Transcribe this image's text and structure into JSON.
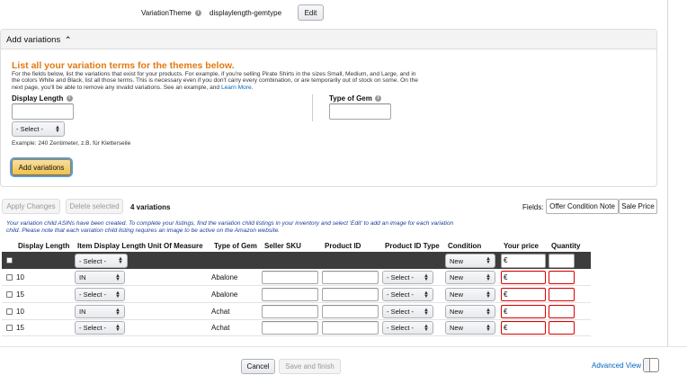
{
  "variation_theme": {
    "label": "VariationTheme",
    "value": "displaylength-gemtype",
    "edit_label": "Edit"
  },
  "add_variations": {
    "header": "Add variations",
    "heading": "List all your variation terms for the themes below.",
    "desc_line1": "For the fields below, list the variations that exist for your products. For example, if you're selling Pirate Shirts in the sizes Small, Medium, and Large, and in",
    "desc_line2": "the colors White and Black, list all those terms. This is necessary even if you don't carry every combination, or are temporarily out of stock on some. On the",
    "desc_line3": "next page, you'll be able to remove any invalid variations. See an example, and",
    "learn_more": "Learn More.",
    "display_length_label": "Display Length",
    "type_of_gem_label": "Type of Gem",
    "select_placeholder": "- Select -",
    "example_text": "Example:  240 Zentimeter, z.B. für Kletterseile",
    "add_button": "Add variations"
  },
  "toolbar": {
    "apply_changes": "Apply Changes",
    "delete_selected": "Delete selected",
    "count": "4 variations",
    "fields_label": "Fields:",
    "offer_condition_note": "Offer Condition Note",
    "sale_price": "Sale Price"
  },
  "notice": {
    "line1": "Your variation child ASINs have been created. To complete your listings, find the variation child listings in your inventory and select 'Edit' to add an image for each variation",
    "line2": "child. Please note that each variation child listing requires an image to be active on the Amazon website."
  },
  "table": {
    "headers": [
      "Display Length",
      "Item Display Length Unit Of Measure",
      "Type of Gem",
      "Seller SKU",
      "Product ID",
      "Product ID Type",
      "Condition",
      "Your price",
      "Quantity"
    ],
    "bulk_row": {
      "unit": "- Select -",
      "condition": "New",
      "currency": "€"
    },
    "rows": [
      {
        "length": "10",
        "unit": "IN",
        "gem": "Abalone",
        "id_type": "- Select -",
        "condition": "New",
        "currency": "€"
      },
      {
        "length": "15",
        "unit": "- Select -",
        "gem": "Abalone",
        "id_type": "- Select -",
        "condition": "New",
        "currency": "€"
      },
      {
        "length": "10",
        "unit": "IN",
        "gem": "Achat",
        "id_type": "- Select -",
        "condition": "New",
        "currency": "€"
      },
      {
        "length": "15",
        "unit": "- Select -",
        "gem": "Achat",
        "id_type": "- Select -",
        "condition": "New",
        "currency": "€"
      }
    ]
  },
  "footer": {
    "cancel": "Cancel",
    "save_finish": "Save and finish",
    "advanced_view": "Advanced View"
  },
  "colors": {
    "heading_orange": "#e47911",
    "link_blue": "#0066c0",
    "notice_blue": "#1a3e9c",
    "error_red": "#d00000",
    "table_dark_row": "#3c3c3c"
  }
}
